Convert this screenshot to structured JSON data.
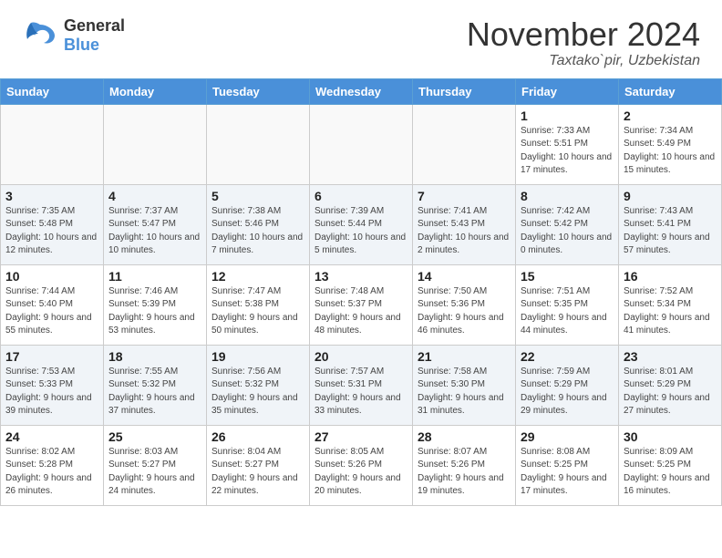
{
  "header": {
    "logo": {
      "general": "General",
      "blue": "Blue"
    },
    "title": "November 2024",
    "location": "Taxtako`pir, Uzbekistan"
  },
  "weekdays": [
    "Sunday",
    "Monday",
    "Tuesday",
    "Wednesday",
    "Thursday",
    "Friday",
    "Saturday"
  ],
  "weeks": [
    [
      {
        "day": "",
        "sunrise": "",
        "sunset": "",
        "daylight": "",
        "empty": true
      },
      {
        "day": "",
        "sunrise": "",
        "sunset": "",
        "daylight": "",
        "empty": true
      },
      {
        "day": "",
        "sunrise": "",
        "sunset": "",
        "daylight": "",
        "empty": true
      },
      {
        "day": "",
        "sunrise": "",
        "sunset": "",
        "daylight": "",
        "empty": true
      },
      {
        "day": "",
        "sunrise": "",
        "sunset": "",
        "daylight": "",
        "empty": true
      },
      {
        "day": "1",
        "sunrise": "Sunrise: 7:33 AM",
        "sunset": "Sunset: 5:51 PM",
        "daylight": "Daylight: 10 hours and 17 minutes.",
        "empty": false
      },
      {
        "day": "2",
        "sunrise": "Sunrise: 7:34 AM",
        "sunset": "Sunset: 5:49 PM",
        "daylight": "Daylight: 10 hours and 15 minutes.",
        "empty": false
      }
    ],
    [
      {
        "day": "3",
        "sunrise": "Sunrise: 7:35 AM",
        "sunset": "Sunset: 5:48 PM",
        "daylight": "Daylight: 10 hours and 12 minutes.",
        "empty": false
      },
      {
        "day": "4",
        "sunrise": "Sunrise: 7:37 AM",
        "sunset": "Sunset: 5:47 PM",
        "daylight": "Daylight: 10 hours and 10 minutes.",
        "empty": false
      },
      {
        "day": "5",
        "sunrise": "Sunrise: 7:38 AM",
        "sunset": "Sunset: 5:46 PM",
        "daylight": "Daylight: 10 hours and 7 minutes.",
        "empty": false
      },
      {
        "day": "6",
        "sunrise": "Sunrise: 7:39 AM",
        "sunset": "Sunset: 5:44 PM",
        "daylight": "Daylight: 10 hours and 5 minutes.",
        "empty": false
      },
      {
        "day": "7",
        "sunrise": "Sunrise: 7:41 AM",
        "sunset": "Sunset: 5:43 PM",
        "daylight": "Daylight: 10 hours and 2 minutes.",
        "empty": false
      },
      {
        "day": "8",
        "sunrise": "Sunrise: 7:42 AM",
        "sunset": "Sunset: 5:42 PM",
        "daylight": "Daylight: 10 hours and 0 minutes.",
        "empty": false
      },
      {
        "day": "9",
        "sunrise": "Sunrise: 7:43 AM",
        "sunset": "Sunset: 5:41 PM",
        "daylight": "Daylight: 9 hours and 57 minutes.",
        "empty": false
      }
    ],
    [
      {
        "day": "10",
        "sunrise": "Sunrise: 7:44 AM",
        "sunset": "Sunset: 5:40 PM",
        "daylight": "Daylight: 9 hours and 55 minutes.",
        "empty": false
      },
      {
        "day": "11",
        "sunrise": "Sunrise: 7:46 AM",
        "sunset": "Sunset: 5:39 PM",
        "daylight": "Daylight: 9 hours and 53 minutes.",
        "empty": false
      },
      {
        "day": "12",
        "sunrise": "Sunrise: 7:47 AM",
        "sunset": "Sunset: 5:38 PM",
        "daylight": "Daylight: 9 hours and 50 minutes.",
        "empty": false
      },
      {
        "day": "13",
        "sunrise": "Sunrise: 7:48 AM",
        "sunset": "Sunset: 5:37 PM",
        "daylight": "Daylight: 9 hours and 48 minutes.",
        "empty": false
      },
      {
        "day": "14",
        "sunrise": "Sunrise: 7:50 AM",
        "sunset": "Sunset: 5:36 PM",
        "daylight": "Daylight: 9 hours and 46 minutes.",
        "empty": false
      },
      {
        "day": "15",
        "sunrise": "Sunrise: 7:51 AM",
        "sunset": "Sunset: 5:35 PM",
        "daylight": "Daylight: 9 hours and 44 minutes.",
        "empty": false
      },
      {
        "day": "16",
        "sunrise": "Sunrise: 7:52 AM",
        "sunset": "Sunset: 5:34 PM",
        "daylight": "Daylight: 9 hours and 41 minutes.",
        "empty": false
      }
    ],
    [
      {
        "day": "17",
        "sunrise": "Sunrise: 7:53 AM",
        "sunset": "Sunset: 5:33 PM",
        "daylight": "Daylight: 9 hours and 39 minutes.",
        "empty": false
      },
      {
        "day": "18",
        "sunrise": "Sunrise: 7:55 AM",
        "sunset": "Sunset: 5:32 PM",
        "daylight": "Daylight: 9 hours and 37 minutes.",
        "empty": false
      },
      {
        "day": "19",
        "sunrise": "Sunrise: 7:56 AM",
        "sunset": "Sunset: 5:32 PM",
        "daylight": "Daylight: 9 hours and 35 minutes.",
        "empty": false
      },
      {
        "day": "20",
        "sunrise": "Sunrise: 7:57 AM",
        "sunset": "Sunset: 5:31 PM",
        "daylight": "Daylight: 9 hours and 33 minutes.",
        "empty": false
      },
      {
        "day": "21",
        "sunrise": "Sunrise: 7:58 AM",
        "sunset": "Sunset: 5:30 PM",
        "daylight": "Daylight: 9 hours and 31 minutes.",
        "empty": false
      },
      {
        "day": "22",
        "sunrise": "Sunrise: 7:59 AM",
        "sunset": "Sunset: 5:29 PM",
        "daylight": "Daylight: 9 hours and 29 minutes.",
        "empty": false
      },
      {
        "day": "23",
        "sunrise": "Sunrise: 8:01 AM",
        "sunset": "Sunset: 5:29 PM",
        "daylight": "Daylight: 9 hours and 27 minutes.",
        "empty": false
      }
    ],
    [
      {
        "day": "24",
        "sunrise": "Sunrise: 8:02 AM",
        "sunset": "Sunset: 5:28 PM",
        "daylight": "Daylight: 9 hours and 26 minutes.",
        "empty": false
      },
      {
        "day": "25",
        "sunrise": "Sunrise: 8:03 AM",
        "sunset": "Sunset: 5:27 PM",
        "daylight": "Daylight: 9 hours and 24 minutes.",
        "empty": false
      },
      {
        "day": "26",
        "sunrise": "Sunrise: 8:04 AM",
        "sunset": "Sunset: 5:27 PM",
        "daylight": "Daylight: 9 hours and 22 minutes.",
        "empty": false
      },
      {
        "day": "27",
        "sunrise": "Sunrise: 8:05 AM",
        "sunset": "Sunset: 5:26 PM",
        "daylight": "Daylight: 9 hours and 20 minutes.",
        "empty": false
      },
      {
        "day": "28",
        "sunrise": "Sunrise: 8:07 AM",
        "sunset": "Sunset: 5:26 PM",
        "daylight": "Daylight: 9 hours and 19 minutes.",
        "empty": false
      },
      {
        "day": "29",
        "sunrise": "Sunrise: 8:08 AM",
        "sunset": "Sunset: 5:25 PM",
        "daylight": "Daylight: 9 hours and 17 minutes.",
        "empty": false
      },
      {
        "day": "30",
        "sunrise": "Sunrise: 8:09 AM",
        "sunset": "Sunset: 5:25 PM",
        "daylight": "Daylight: 9 hours and 16 minutes.",
        "empty": false
      }
    ]
  ]
}
